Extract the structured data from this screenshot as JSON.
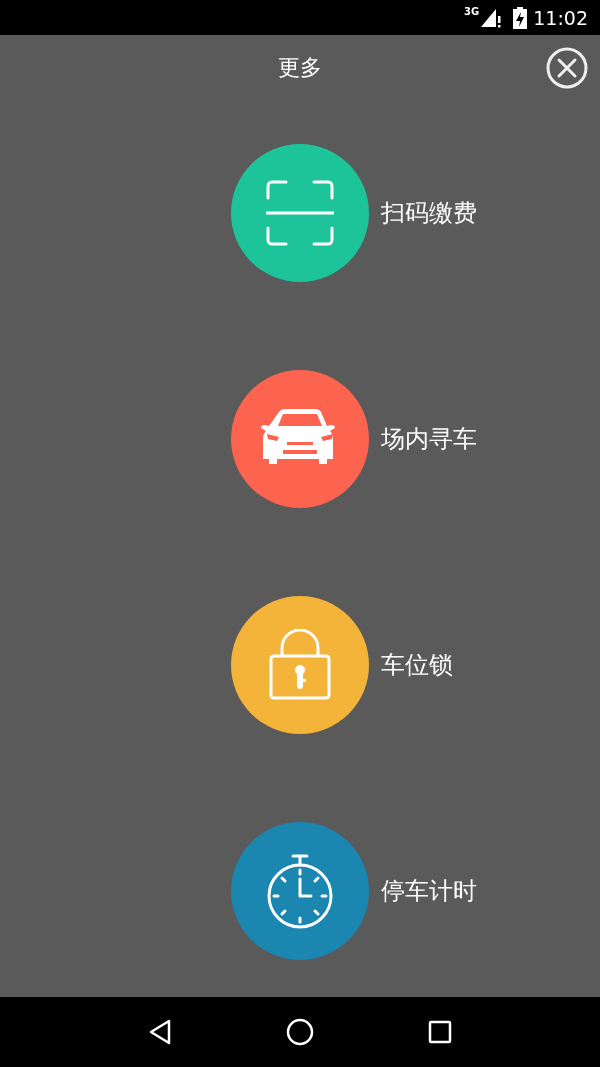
{
  "status_bar": {
    "network": "3G",
    "time": "11:02"
  },
  "header": {
    "title": "更多"
  },
  "items": [
    {
      "kind": "scan",
      "label": "扫码缴费",
      "color": "#1dc49a"
    },
    {
      "kind": "car",
      "label": "场内寻车",
      "color": "#fc6450"
    },
    {
      "kind": "lock",
      "label": "车位锁",
      "color": "#f4b43a"
    },
    {
      "kind": "timer",
      "label": "停车计时",
      "color": "#1b86b0"
    }
  ]
}
